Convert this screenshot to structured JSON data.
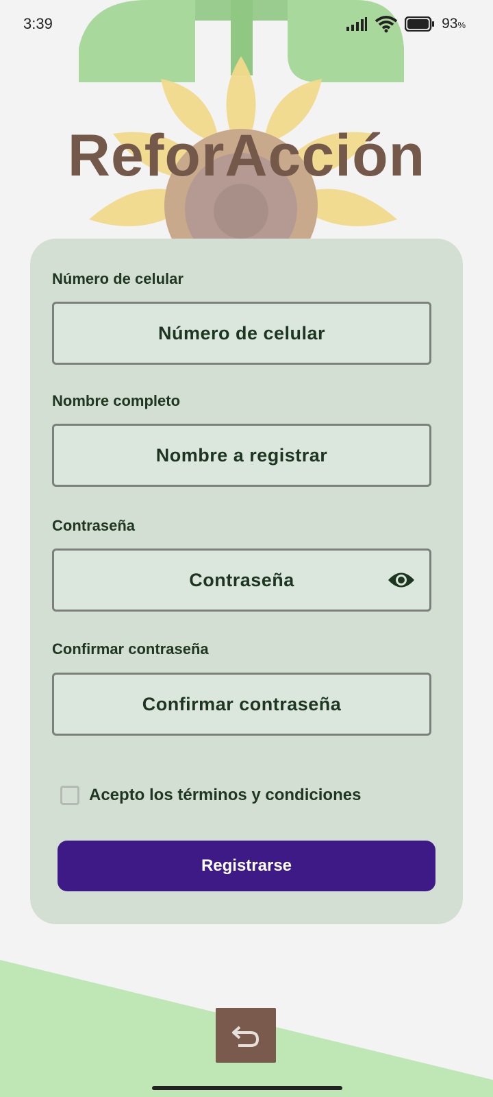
{
  "status_bar": {
    "time": "3:39",
    "battery_percent": "93",
    "battery_unit": "%",
    "icons": [
      "signal-icon",
      "wifi-icon",
      "battery-icon"
    ]
  },
  "app": {
    "title": "ReforAcción"
  },
  "form": {
    "phone": {
      "label": "Número de celular",
      "placeholder": "Número de celular"
    },
    "name": {
      "label": "Nombre completo",
      "placeholder": "Nombre a registrar"
    },
    "password": {
      "label": "Contraseña",
      "placeholder": "Contraseña",
      "toggle_icon": "eye-icon"
    },
    "confirm_password": {
      "label": "Confirmar contraseña",
      "placeholder": "Confirmar contraseña"
    },
    "terms": {
      "label": "Acepto los términos y condiciones",
      "checked": false
    },
    "submit_label": "Registrarse"
  },
  "navigation": {
    "back_icon": "back-arrow-icon"
  },
  "colors": {
    "title": "#74594a",
    "card": "#d3dfd2",
    "button": "#3d1a86",
    "text_dark": "#1f3622",
    "sunflower_petal": "#f0d98a",
    "leaf": "#a7d89c",
    "back_button": "#7a5a4c"
  }
}
